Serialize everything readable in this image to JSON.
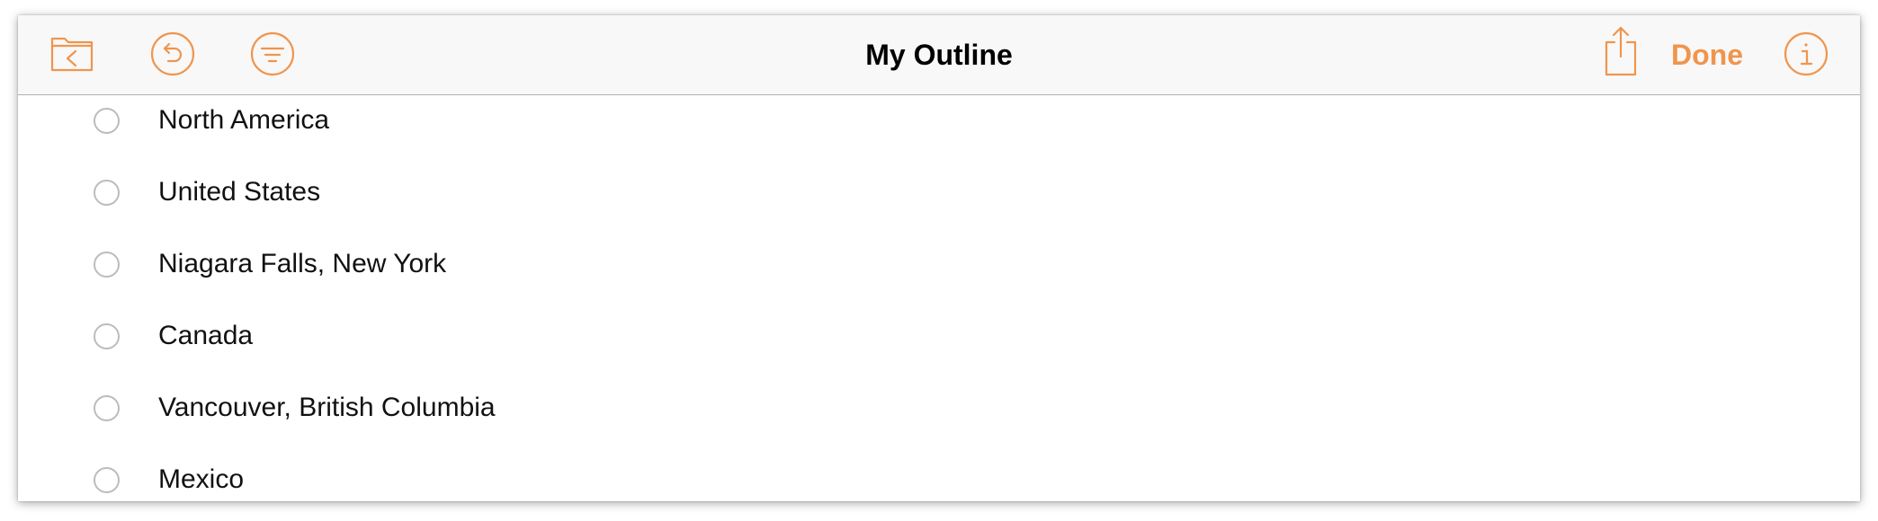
{
  "toolbar": {
    "title": "My Outline",
    "done_label": "Done",
    "icons": {
      "back": "folder-back-icon",
      "undo": "undo-icon",
      "filter": "filter-icon",
      "share": "share-icon",
      "info": "info-icon"
    },
    "accent_color": "#f0954d"
  },
  "outline": {
    "rows": [
      {
        "text": "North America"
      },
      {
        "text": "United States"
      },
      {
        "text": "Niagara Falls, New York"
      },
      {
        "text": "Canada"
      },
      {
        "text": "Vancouver, British Columbia"
      },
      {
        "text": "Mexico"
      }
    ]
  }
}
